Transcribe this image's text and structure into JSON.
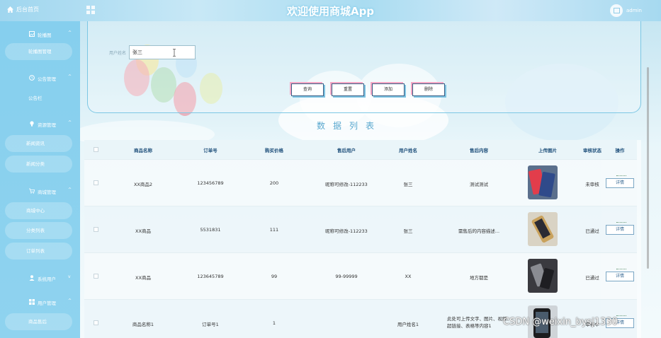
{
  "header": {
    "home_label": "后台首页",
    "app_title": "欢迎使用商城App",
    "user_label": "admin"
  },
  "sidebar": {
    "groups": [
      {
        "label": "轮播图",
        "icon": "image-icon",
        "items": [
          "轮播图管理"
        ]
      },
      {
        "label": "公告管理",
        "icon": "clock-icon",
        "items": [
          "公告栏"
        ]
      },
      {
        "label": "资源管理",
        "icon": "bulb-icon",
        "items": [
          "新闻资讯",
          "新闻分类"
        ]
      },
      {
        "label": "商城管理",
        "icon": "cart-icon",
        "items": [
          "商城中心",
          "分类列表",
          "订单列表"
        ]
      },
      {
        "label": "系统用户",
        "icon": "user-icon",
        "items": []
      },
      {
        "label": "用户管理",
        "icon": "grid-icon",
        "items": [
          "商品售后"
        ]
      }
    ]
  },
  "search": {
    "user_label": "用户姓名",
    "user_value": "张三",
    "buttons": [
      "查询",
      "重置",
      "添加",
      "删除"
    ]
  },
  "list_title": "数据列表",
  "table": {
    "headers": [
      "商品名称",
      "订单号",
      "购买价格",
      "售后用户",
      "用户姓名",
      "售后内容",
      "上传图片",
      "审核状态",
      "操作"
    ],
    "rows": [
      {
        "name": "XX商品2",
        "order": "123456789",
        "price": "200",
        "after_user": "昵称可修改-112233",
        "user": "张三",
        "content": "测试测试",
        "image": "phone-red-icon",
        "status": "未审核",
        "action": "详情"
      },
      {
        "name": "XX商品",
        "order": "5531831",
        "price": "111",
        "after_user": "昵称可修改-112233",
        "user": "张三",
        "content": "需售后的内容描述...",
        "image": "phone-gold-icon",
        "status": "已通过",
        "action": "详情"
      },
      {
        "name": "XX商品",
        "order": "123645789",
        "price": "99",
        "after_user": "99-99999",
        "user": "XX",
        "content": "地方都是",
        "image": "phone-dark-icon",
        "status": "已通过",
        "action": "详情"
      },
      {
        "name": "商品名称1",
        "order": "订单号1",
        "price": "1",
        "after_user": "",
        "user": "用户姓名1",
        "content": "此处可上传文字、图片、视频、超链接、表格等内容1",
        "image": "phone-black-icon",
        "status": "审核中",
        "action": "详情"
      }
    ]
  },
  "watermark": "CSDN @weixin_bysj1330",
  "colors": {
    "sidebar": "#8fd3ef",
    "accent": "#5aa8cf",
    "header_text": "#1d4e7a"
  }
}
